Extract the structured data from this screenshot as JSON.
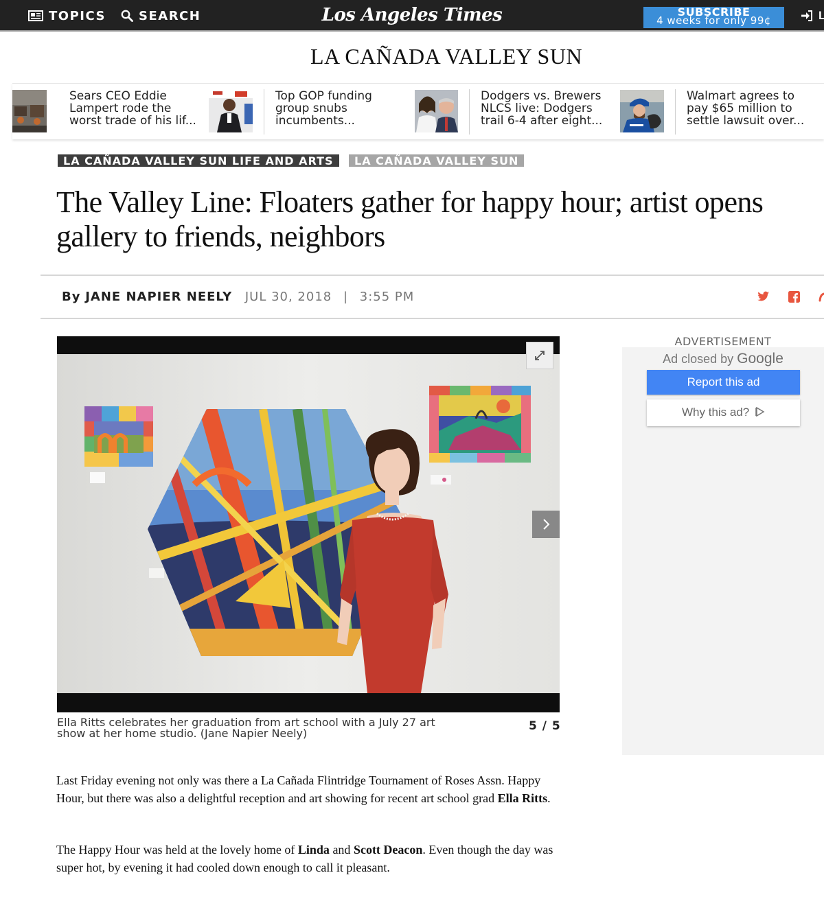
{
  "nav": {
    "topics_label": "TOPICS",
    "search_label": "SEARCH",
    "brand": "Los Angeles Times",
    "subscribe_line1": "SUBSCRIBE",
    "subscribe_line2": "4 weeks for only 99¢",
    "login_label": "L"
  },
  "section_title": "LA CAÑADA VALLEY SUN",
  "rail": [
    {
      "headline": "Sears CEO Eddie Lampert rode the worst trade of his lif...",
      "thumb_icon": "sears-store-photo"
    },
    {
      "headline": "Top GOP funding group snubs incumbents...",
      "thumb_icon": "gop-event-photo"
    },
    {
      "headline": "Dodgers vs. Brewers NLCS live: Dodgers trail 6-4 after eight...",
      "thumb_icon": "politicians-photo"
    },
    {
      "headline": "Walmart agrees to pay $65 million to settle lawsuit over...",
      "thumb_icon": "dodgers-player-photo"
    }
  ],
  "labels": {
    "primary": "LA CAÑADA VALLEY SUN LIFE AND ARTS",
    "secondary": "LA CAÑADA VALLEY SUN"
  },
  "article": {
    "title": "The Valley Line: Floaters gather for happy hour; artist opens gallery to friends, neighbors",
    "byline_prefix": "By",
    "author": "JANE NAPIER NEELY",
    "date": "JUL 30, 2018",
    "separator": "|",
    "time": "3:55 PM"
  },
  "share": {
    "icons": [
      "twitter-icon",
      "facebook-icon",
      "reddit-icon"
    ],
    "accent_color": "#e8563f"
  },
  "gallery": {
    "caption": "Ella Ritts celebrates her graduation from art school with a July 27 art show at her home studio. (Jane Napier Neely)",
    "counter": "5 / 5"
  },
  "ad": {
    "label": "ADVERTISEMENT",
    "closed_text": "Ad closed by",
    "closed_brand": "Google",
    "report_label": "Report this ad",
    "why_label": "Why this ad?",
    "report_color": "#4285f4"
  },
  "body": {
    "p1_text1": "Last Friday evening not only was there a La Cañada Flintridge Tournament of Roses Assn. Happy Hour, but there was also a delightful reception and art showing for recent art school grad ",
    "p1_bold1": "Ella Ritts",
    "p1_text2": ".",
    "p2_text1": "The Happy Hour was held at the lovely home of ",
    "p2_bold1": "Linda",
    "p2_text2": " and ",
    "p2_bold2": "Scott Deacon",
    "p2_text3": ". Even though the day was super hot, by evening it had cooled down enough to call it pleasant."
  }
}
